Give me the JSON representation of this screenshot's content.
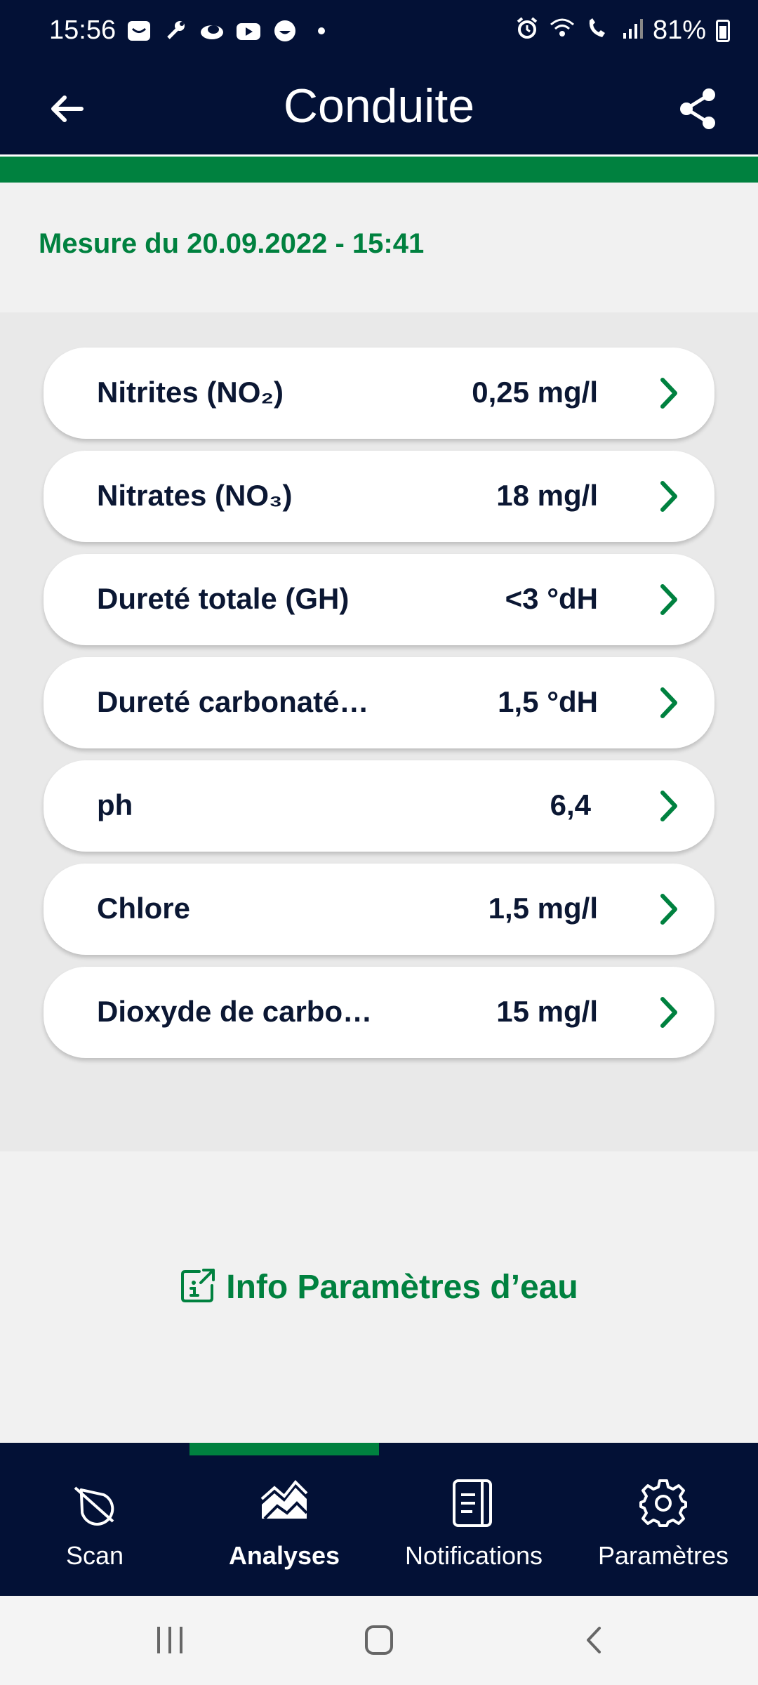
{
  "status_bar": {
    "time": "15:56",
    "battery": "81%",
    "notification_icons": [
      "mail-icon",
      "tools-icon",
      "cloud-icon",
      "youtube-icon",
      "smiley-icon",
      "dot-icon"
    ],
    "system_icons": [
      "alarm-icon",
      "wifi-icon",
      "call-icon",
      "signal-icon",
      "battery-icon"
    ]
  },
  "app_bar": {
    "title": "Conduite",
    "back_icon": "arrow-left-icon",
    "share_icon": "share-icon"
  },
  "measurement": {
    "date_label": "Mesure du 20.09.2022 - 15:41"
  },
  "parameters": [
    {
      "name": "Nitrites (NO₂)",
      "value": "0,25 mg/l"
    },
    {
      "name": "Nitrates (NO₃)",
      "value": "18 mg/l"
    },
    {
      "name": "Dureté totale (GH)",
      "value": "<3 °dH"
    },
    {
      "name": "Dureté carbonaté…",
      "value": "1,5 °dH"
    },
    {
      "name": "ph",
      "value": "6,4"
    },
    {
      "name": "Chlore",
      "value": "1,5 mg/l"
    },
    {
      "name": "Dioxyde de carbo…",
      "value": "15 mg/l"
    }
  ],
  "info_link": {
    "label": "Info Paramètres d’eau"
  },
  "bottom_nav": {
    "items": [
      {
        "label": "Scan",
        "icon": "droplet-scan-icon",
        "active": false
      },
      {
        "label": "Analyses",
        "icon": "chart-mountain-icon",
        "active": true
      },
      {
        "label": "Notifications",
        "icon": "document-icon",
        "active": false
      },
      {
        "label": "Paramètres",
        "icon": "gear-icon",
        "active": false
      }
    ]
  },
  "colors": {
    "navy": "#031136",
    "accent_green": "#00813f",
    "background": "#f1f1f1"
  }
}
